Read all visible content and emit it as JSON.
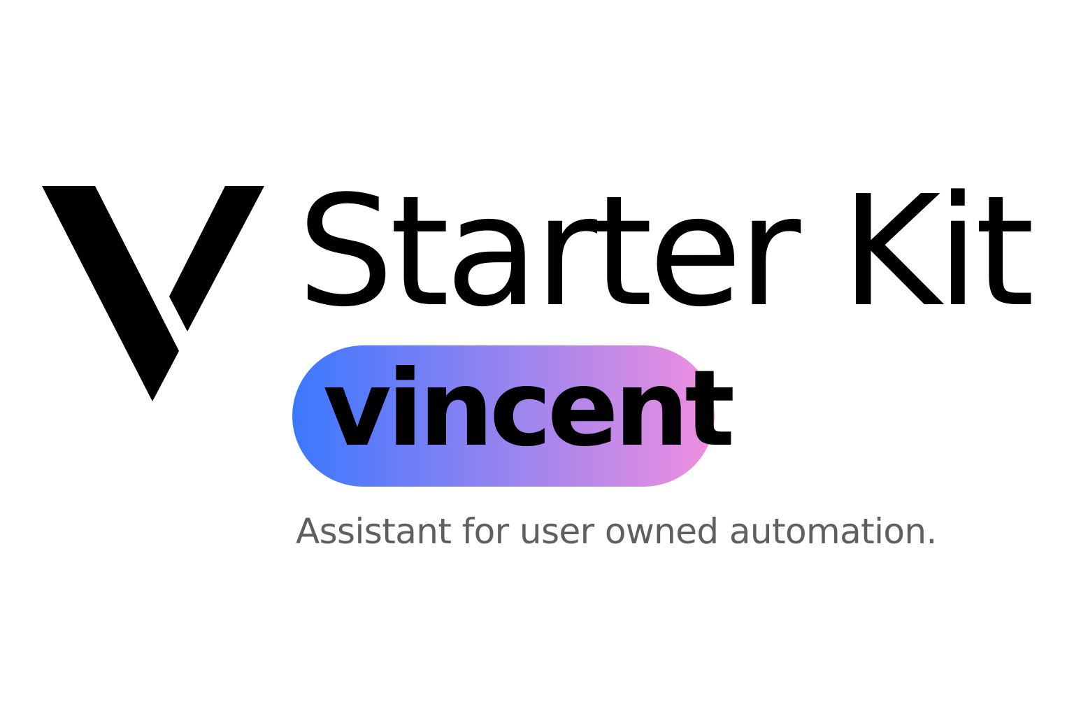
{
  "brand": {
    "mark_icon": "v-logo-icon",
    "mark_color": "#000000",
    "title": "Starter Kit",
    "badge_label": "vincent",
    "badge_gradient": [
      "#3b78ff",
      "#f08fe0"
    ],
    "tagline": "Assistant for user owned automation."
  }
}
